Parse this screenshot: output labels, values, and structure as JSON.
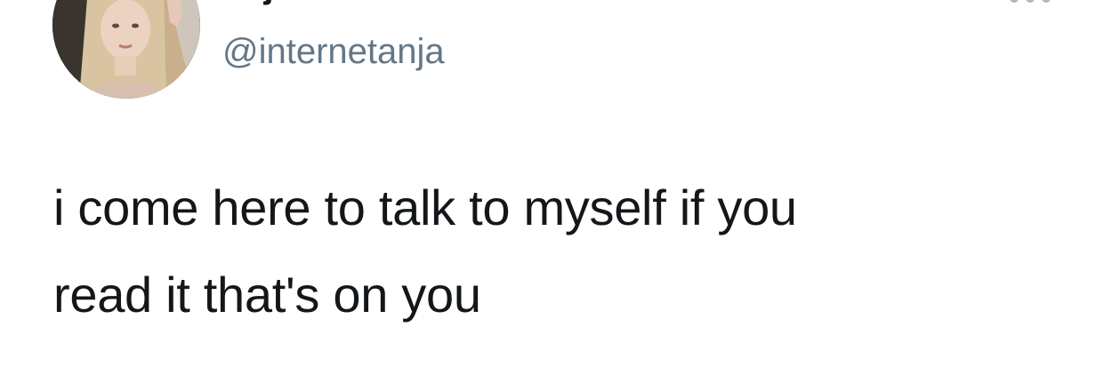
{
  "tweet": {
    "author": {
      "display_name": "anja",
      "handle": "@internetanja",
      "avatar_icon": "profile-photo"
    },
    "more_icon": "ellipsis-icon",
    "text_lines": [
      "i come here to talk to myself if you",
      "read it that's on you"
    ]
  },
  "colors": {
    "background": "#ffffff",
    "text": "#14171a",
    "handle": "#657786",
    "more_icon": "#aab8c2"
  }
}
